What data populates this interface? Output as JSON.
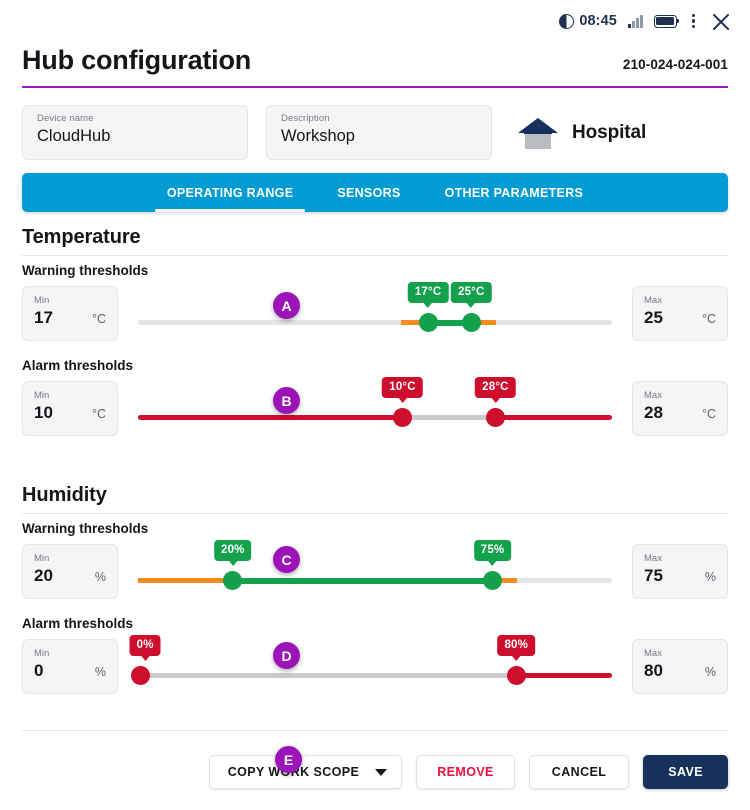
{
  "statusbar": {
    "time": "08:45",
    "contrast_icon": "contrast-half-circle-icon",
    "signal_icon": "signal-bars-icon",
    "battery_icon": "battery-full-icon",
    "menu_icon": "kebab-menu-icon",
    "close_icon": "close-x-icon"
  },
  "header": {
    "title": "Hub configuration",
    "serial": "210-024-024-001",
    "rule_color": "#9c1bbd"
  },
  "device": {
    "name_label": "Device name",
    "name_value": "CloudHub",
    "description_label": "Description",
    "description_value": "Workshop",
    "place_icon": "house-icon",
    "place_name": "Hospital"
  },
  "tabs": {
    "bar_color": "#009cd3",
    "items": [
      {
        "label": "OPERATING RANGE",
        "active": true
      },
      {
        "label": "SENSORS",
        "active": false
      },
      {
        "label": "OTHER PARAMETERS",
        "active": false
      }
    ]
  },
  "sections": [
    {
      "title": "Temperature",
      "rows": [
        {
          "label": "Warning thresholds",
          "kind": "warning",
          "badge": "A",
          "min_label": "Min",
          "min_value": "17",
          "min_unit": "°C",
          "max_label": "Max",
          "max_value": "25",
          "max_unit": "°C",
          "low_bubble": "17°C",
          "high_bubble": "25°C"
        },
        {
          "label": "Alarm thresholds",
          "kind": "alarm",
          "badge": "B",
          "min_label": "Min",
          "min_value": "10",
          "min_unit": "°C",
          "max_label": "Max",
          "max_value": "28",
          "max_unit": "°C",
          "low_bubble": "10°C",
          "high_bubble": "28°C"
        }
      ]
    },
    {
      "title": "Humidity",
      "rows": [
        {
          "label": "Warning thresholds",
          "kind": "warning",
          "badge": "C",
          "min_label": "Min",
          "min_value": "20",
          "min_unit": "%",
          "max_label": "Max",
          "max_value": "75",
          "max_unit": "%",
          "low_bubble": "20%",
          "high_bubble": "75%"
        },
        {
          "label": "Alarm thresholds",
          "kind": "alarm",
          "badge": "D",
          "min_label": "Min",
          "min_value": "0",
          "min_unit": "%",
          "max_label": "Max",
          "max_value": "80",
          "max_unit": "%",
          "low_bubble": "0%",
          "high_bubble": "80%"
        }
      ]
    }
  ],
  "footer": {
    "badge": "E",
    "copy_label": "COPY WORK SCOPE",
    "copy_caret_icon": "chevron-down-icon",
    "remove_label": "REMOVE",
    "cancel_label": "CANCEL",
    "save_label": "SAVE"
  },
  "colors": {
    "warning_green": "#13a14c",
    "warning_orange": "#f68b1f",
    "alarm_red": "#ce0e2d",
    "tab_blue": "#009cd3",
    "accent_purple": "#9c13b8",
    "save_navy": "#16325c",
    "remove_red": "#e8113c"
  }
}
